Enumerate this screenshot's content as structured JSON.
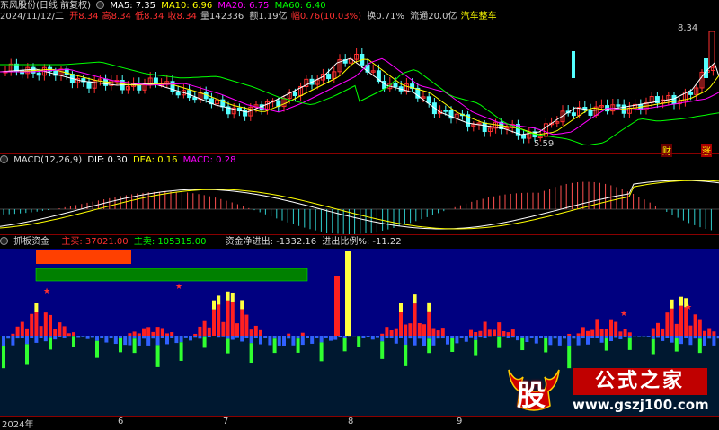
{
  "header": {
    "stock_name": "东风股份(日线 前复权)",
    "ma": [
      {
        "label": "MA5: 7.35",
        "color": "#ffffff"
      },
      {
        "label": "MA10: 6.96",
        "color": "#ffff00"
      },
      {
        "label": "MA20: 6.75",
        "color": "#ff00ff"
      },
      {
        "label": "MA60: 6.40",
        "color": "#00ff00"
      }
    ],
    "info_line": [
      {
        "text": "2024/11/12/二",
        "color": "#cccccc"
      },
      {
        "text": "开8.34",
        "color": "#ff3030"
      },
      {
        "text": "高8.34",
        "color": "#ff3030"
      },
      {
        "text": "低8.34",
        "color": "#ff3030"
      },
      {
        "text": "收8.34",
        "color": "#ff3030"
      },
      {
        "text": "量142336",
        "color": "#cccccc"
      },
      {
        "text": "额1.19亿",
        "color": "#cccccc"
      },
      {
        "text": "幅0.76(10.03%)",
        "color": "#ff3030"
      },
      {
        "text": "换0.71%",
        "color": "#cccccc"
      },
      {
        "text": "流通20.0亿",
        "color": "#cccccc"
      },
      {
        "text": "汽车整车",
        "color": "#ffff00"
      }
    ],
    "high_label": "8.34",
    "low_label": "5.59",
    "marker_cai": "财",
    "marker_zhang": "涨"
  },
  "macd": {
    "title": "MACD(12,26,9)",
    "dif": "DIF: 0.30",
    "dea": "DEA: 0.16",
    "macd": "MACD: 0.28"
  },
  "capital": {
    "title": "抓板资金",
    "buy_label": "主买: 37021.00",
    "sell_label": "主卖: 105315.00",
    "net_label": "资金净进出: -1332.16",
    "ratio_label": "进出比例%: -11.22"
  },
  "xaxis": {
    "labels": [
      "2024年",
      "6",
      "7",
      "8",
      "9"
    ]
  },
  "watermark": {
    "gu": "股",
    "name": "公式之家",
    "url": "www.gszj100.com"
  },
  "colors": {
    "up": "#ff3030",
    "down": "#54ffff",
    "ma5": "#ffffff",
    "ma10": "#ffff00",
    "ma20": "#ff00ff",
    "ma60": "#00ff00",
    "capital_bg": "#000080",
    "buy_bar": "#ff2020",
    "sell_bar": "#3060ff",
    "highlight_bar": "#ffff40",
    "green_bar": "#30ff30",
    "buy_box": "#ff4000",
    "sell_box": "#008000"
  }
}
